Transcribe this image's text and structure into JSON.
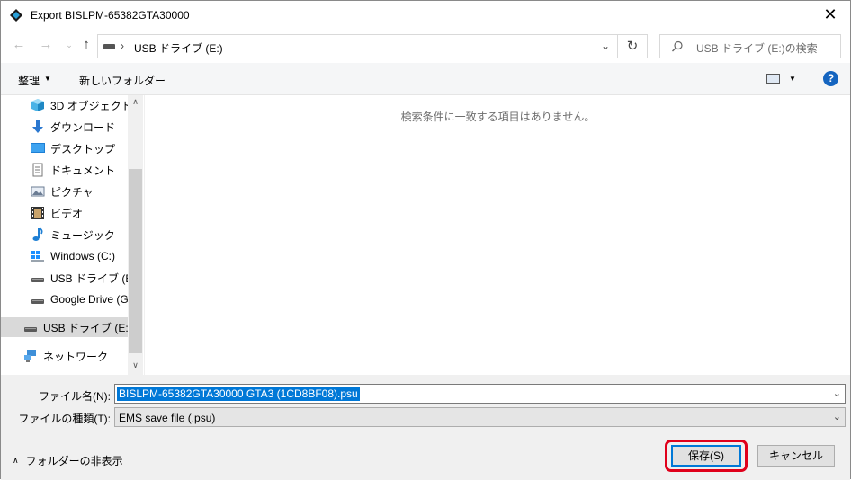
{
  "window": {
    "title": "Export BISLPM-65382GTA30000",
    "close_glyph": "✕"
  },
  "address": {
    "path_sep": "›",
    "location": "USB ドライブ (E:)",
    "dropdown_glyph": "⌄",
    "refresh_glyph": "↻",
    "search_placeholder": "USB ドライブ (E:)の検索"
  },
  "nav_glyphs": {
    "back": "←",
    "forward": "→",
    "recent": "⌄",
    "up": "↑"
  },
  "toolbar": {
    "organize_label": "整理",
    "dropdown_glyph": "▼",
    "new_folder_label": "新しいフォルダー",
    "help_label": "?"
  },
  "sidebar": {
    "items": [
      {
        "label": "3D オブジェクト",
        "icon": "cube-icon"
      },
      {
        "label": "ダウンロード",
        "icon": "download-arrow-icon"
      },
      {
        "label": "デスクトップ",
        "icon": "desktop-icon"
      },
      {
        "label": "ドキュメント",
        "icon": "document-icon"
      },
      {
        "label": "ピクチャ",
        "icon": "picture-icon"
      },
      {
        "label": "ビデオ",
        "icon": "video-icon"
      },
      {
        "label": "ミュージック",
        "icon": "music-note-icon"
      },
      {
        "label": "Windows (C:)",
        "icon": "windows-drive-icon"
      },
      {
        "label": "USB ドライブ (E:)",
        "icon": "usb-drive-icon"
      },
      {
        "label": "Google Drive (G:",
        "icon": "drive-icon"
      },
      {
        "label": "USB ドライブ (E:)",
        "icon": "usb-drive-icon",
        "selected": true
      },
      {
        "label": "ネットワーク",
        "icon": "network-icon"
      }
    ],
    "scroll_up_glyph": "∧",
    "scroll_down_glyph": "∨"
  },
  "content": {
    "empty_message": "検索条件に一致する項目はありません。"
  },
  "form": {
    "filename_label": "ファイル名(N):",
    "filename_value": "BISLPM-65382GTA30000 GTA3 (1CD8BF08).psu",
    "filetype_label": "ファイルの種類(T):",
    "filetype_value": "EMS save file (.psu)",
    "dropdown_glyph": "⌄"
  },
  "footer": {
    "hide_folders_label": "フォルダーの非表示",
    "hide_folders_glyph": "∧",
    "save_label": "保存(S)",
    "cancel_label": "キャンセル"
  },
  "colors": {
    "accent": "#0078d7",
    "highlight": "#e0001b",
    "help_icon": "#1565c0"
  }
}
